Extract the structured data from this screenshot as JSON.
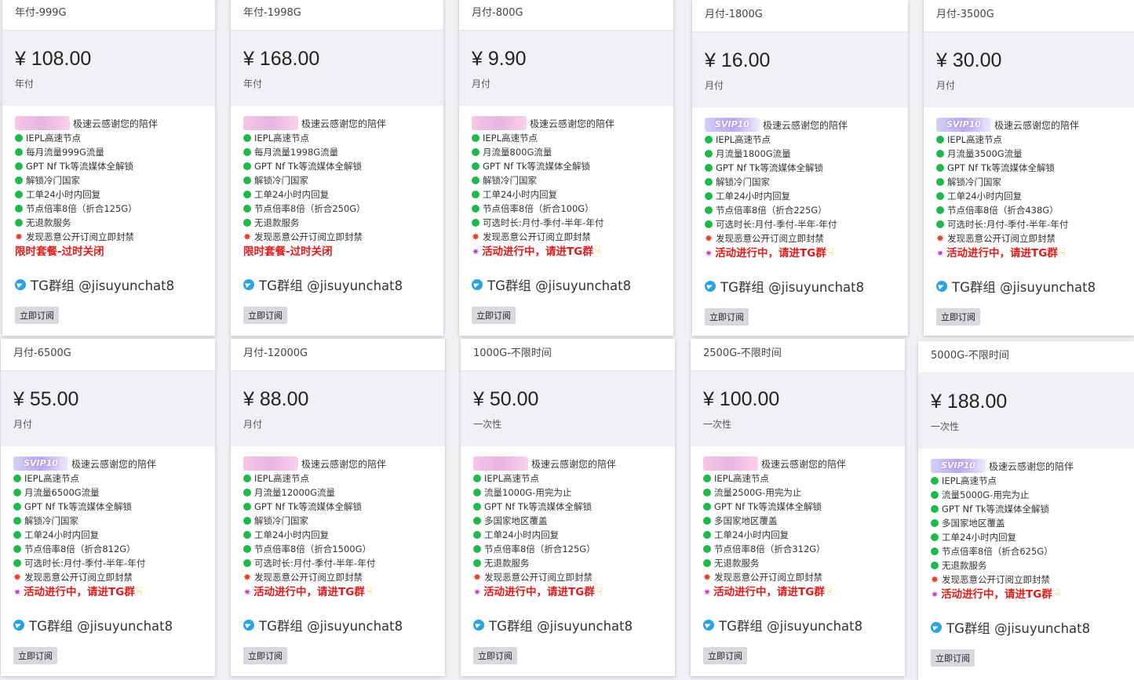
{
  "common": {
    "banner_text": "极速云感谢您的陪伴",
    "vip_label": "SVIP10",
    "tg_text": "TG群组 @jisuyunchat8",
    "subscribe_label": "立即订阅",
    "colors": {
      "feature_dot": "#1fb84b",
      "promo_red": "#e31b1b",
      "price_bg": "#f0f1f5"
    }
  },
  "cards": [
    {
      "title": "年付-999G",
      "price": "¥ 108.00",
      "period": "年付",
      "banner": "pink",
      "features": [
        "IEPL高速节点",
        "每月流量999G流量",
        "GPT Nf Tk等流媒体全解锁",
        "解锁冷门国家",
        "工单24小时内回复",
        "节点倍率8倍（折合125G）",
        "无退款服务"
      ],
      "warn": "发现恶意公开订阅立即封禁",
      "promo": "限时套餐-过时关闭",
      "promo_icons": false
    },
    {
      "title": "年付-1998G",
      "price": "¥ 168.00",
      "period": "年付",
      "banner": "pink",
      "features": [
        "IEPL高速节点",
        "每月流量1998G流量",
        "GPT Nf Tk等流媒体全解锁",
        "解锁冷门国家",
        "工单24小时内回复",
        "节点倍率8倍（折合250G）",
        "无退款服务"
      ],
      "warn": "发现恶意公开订阅立即封禁",
      "promo": "限时套餐-过时关闭",
      "promo_icons": false
    },
    {
      "title": "月付-800G",
      "price": "¥ 9.90",
      "period": "月付",
      "banner": "pink",
      "features": [
        "IEPL高速节点",
        "月流量800G流量",
        "GPT Nf Tk等流媒体全解锁",
        "解锁冷门国家",
        "工单24小时内回复",
        "节点倍率8倍（折合100G）",
        "可选时长:月付-季付-半年-年付"
      ],
      "warn": "发现恶意公开订阅立即封禁",
      "promo": "活动进行中，请进TG群",
      "promo_icons": true
    },
    {
      "title": "月付-1800G",
      "price": "¥ 16.00",
      "period": "月付",
      "banner": "vip",
      "features": [
        "IEPL高速节点",
        "月流量1800G流量",
        "GPT Nf Tk等流媒体全解锁",
        "解锁冷门国家",
        "工单24小时内回复",
        "节点倍率8倍（折合225G）",
        "可选时长:月付-季付-半年-年付"
      ],
      "warn": "发现恶意公开订阅立即封禁",
      "promo": "活动进行中，请进TG群",
      "promo_icons": true
    },
    {
      "title": "月付-3500G",
      "price": "¥ 30.00",
      "period": "月付",
      "banner": "vip",
      "features": [
        "IEPL高速节点",
        "月流量3500G流量",
        "GPT Nf Tk等流媒体全解锁",
        "解锁冷门国家",
        "工单24小时内回复",
        "节点倍率8倍（折合438G）",
        "可选时长:月付-季付-半年-年付"
      ],
      "warn": "发现恶意公开订阅立即封禁",
      "promo": "活动进行中，请进TG群",
      "promo_icons": true
    },
    {
      "title": "月付-6500G",
      "price": "¥ 55.00",
      "period": "月付",
      "banner": "vip",
      "features": [
        "IEPL高速节点",
        "月流量6500G流量",
        "GPT Nf Tk等流媒体全解锁",
        "解锁冷门国家",
        "工单24小时内回复",
        "节点倍率8倍（折合812G）",
        "可选时长:月付-季付-半年-年付"
      ],
      "warn": "发现恶意公开订阅立即封禁",
      "promo": "活动进行中，请进TG群",
      "promo_icons": true
    },
    {
      "title": "月付-12000G",
      "price": "¥ 88.00",
      "period": "月付",
      "banner": "pink",
      "features": [
        "IEPL高速节点",
        "月流量12000G流量",
        "GPT Nf Tk等流媒体全解锁",
        "解锁冷门国家",
        "工单24小时内回复",
        "节点倍率8倍（折合1500G）",
        "可选时长:月付-季付-半年-年付"
      ],
      "warn": "发现恶意公开订阅立即封禁",
      "promo": "活动进行中，请进TG群",
      "promo_icons": true
    },
    {
      "title": "1000G-不限时间",
      "price": "¥ 50.00",
      "period": "一次性",
      "banner": "pink",
      "features": [
        "IEPL高速节点",
        "流量1000G-用完为止",
        "GPT Nf Tk等流媒体全解锁",
        "多国家地区覆盖",
        "工单24小时内回复",
        "节点倍率8倍（折合125G）",
        "无退款服务"
      ],
      "warn": "发现恶意公开订阅立即封禁",
      "promo": "活动进行中，请进TG群",
      "promo_icons": true
    },
    {
      "title": "2500G-不限时间",
      "price": "¥ 100.00",
      "period": "一次性",
      "banner": "pink",
      "features": [
        "IEPL高速节点",
        "流量2500G-用完为止",
        "GPT Nf Tk等流媒体全解锁",
        "多国家地区覆盖",
        "工单24小时内回复",
        "节点倍率8倍（折合312G）",
        "无退款服务"
      ],
      "warn": "发现恶意公开订阅立即封禁",
      "promo": "活动进行中，请进TG群",
      "promo_icons": true
    },
    {
      "title": "5000G-不限时间",
      "price": "¥ 188.00",
      "period": "一次性",
      "banner": "vip",
      "features": [
        "IEPL高速节点",
        "流量5000G-用完为止",
        "GPT Nf Tk等流媒体全解锁",
        "多国家地区覆盖",
        "工单24小时内回复",
        "节点倍率8倍（折合625G）",
        "无退款服务"
      ],
      "warn": "发现恶意公开订阅立即封禁",
      "promo": "活动进行中，请进TG群",
      "promo_icons": true
    }
  ]
}
